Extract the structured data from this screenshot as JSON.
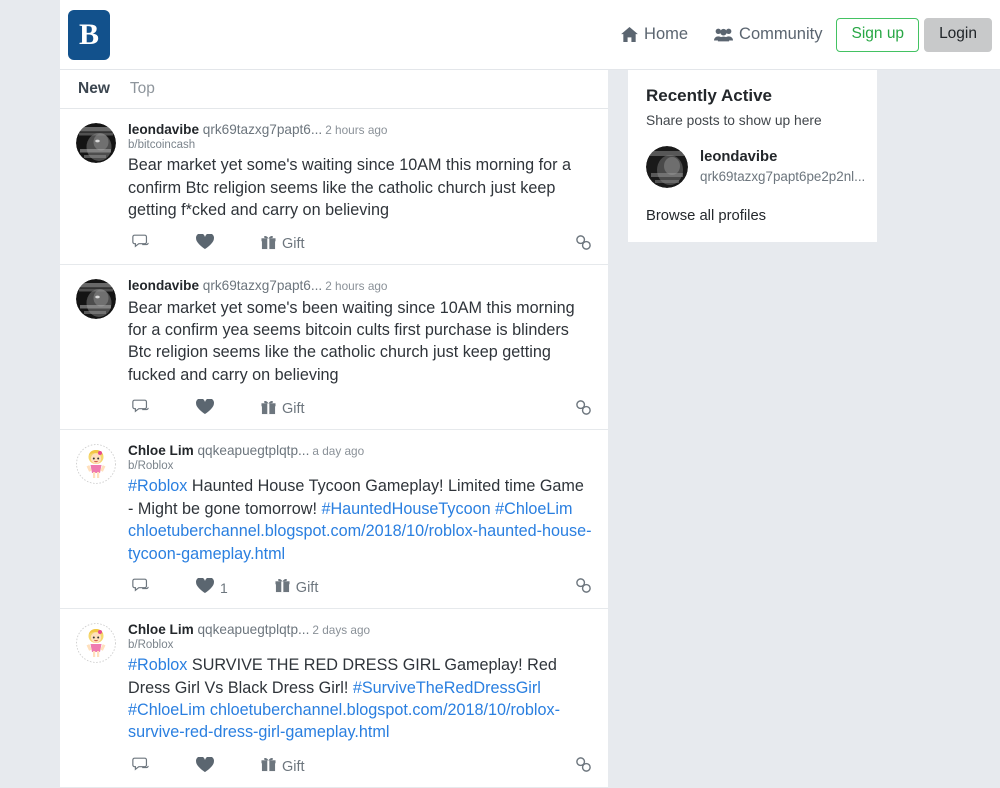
{
  "header": {
    "logo_letter": "B",
    "nav": [
      {
        "label": "Home",
        "icon": "home-icon"
      },
      {
        "label": "Community",
        "icon": "community-icon"
      }
    ],
    "signup_label": "Sign up",
    "login_label": "Login"
  },
  "feed": {
    "tabs": [
      {
        "label": "New",
        "active": true
      },
      {
        "label": "Top",
        "active": false
      }
    ],
    "posts": [
      {
        "author": "leondavibe",
        "handle": "qrk69tazxg7papt6...",
        "time": "2 hours ago",
        "board": "b/bitcoincash",
        "avatar": "leondavibe-avatar",
        "text": "Bear market yet some's waiting since 10AM this morning for a confirm Btc religion seems like the catholic church just keep getting f*cked and carry on believing",
        "gift_label": "Gift",
        "like_count": ""
      },
      {
        "author": "leondavibe",
        "handle": "qrk69tazxg7papt6...",
        "time": "2 hours ago",
        "board": "",
        "avatar": "leondavibe-avatar",
        "text": "Bear market yet some's been waiting since 10AM this morning for a confirm yea seems bitcoin cults first purchase is blinders Btc religion seems like the catholic church just keep getting fucked and carry on believing",
        "gift_label": "Gift",
        "like_count": ""
      },
      {
        "author": "Chloe Lim",
        "handle": "qqkeapuegtplqtp...",
        "time": "a day ago",
        "board": "b/Roblox",
        "avatar": "chloelim-avatar",
        "text_parts": [
          {
            "t": "#Roblox",
            "link": true
          },
          {
            "t": " Haunted House Tycoon Gameplay! Limited time Game - Might be gone tomorrow! ",
            "link": false
          },
          {
            "t": "#HauntedHouseTycoon",
            "link": true
          },
          {
            "t": " ",
            "link": false
          },
          {
            "t": "#ChloeLim",
            "link": true
          },
          {
            "t": " ",
            "link": false
          },
          {
            "t": "chloetuberchannel.blogspot.com/2018/10/roblox-haunted-house-tycoon-gameplay.html",
            "link": true
          }
        ],
        "gift_label": "Gift",
        "like_count": "1"
      },
      {
        "author": "Chloe Lim",
        "handle": "qqkeapuegtplqtp...",
        "time": "2 days ago",
        "board": "b/Roblox",
        "avatar": "chloelim-avatar",
        "text_parts": [
          {
            "t": "#Roblox",
            "link": true
          },
          {
            "t": " SURVIVE THE RED DRESS GIRL Gameplay! Red Dress Girl Vs Black Dress Girl! ",
            "link": false
          },
          {
            "t": "#SurviveTheRedDressGirl",
            "link": true
          },
          {
            "t": " ",
            "link": false
          },
          {
            "t": "#ChloeLim",
            "link": true
          },
          {
            "t": " ",
            "link": false
          },
          {
            "t": "chloetuberchannel.blogspot.com/2018/10/roblox-survive-red-dress-girl-gameplay.html",
            "link": true
          }
        ],
        "gift_label": "Gift",
        "like_count": ""
      }
    ]
  },
  "sidebar": {
    "title": "Recently Active",
    "subtitle": "Share posts to show up here",
    "profile": {
      "name": "leondavibe",
      "handle": "qrk69tazxg7papt6pe2p2nl..."
    },
    "browse_label": "Browse all profiles"
  },
  "colors": {
    "page_bg": "#e7eaee",
    "card_bg": "#ffffff",
    "link": "#2a7fe0",
    "brand": "#12518c",
    "signup_green": "#28a745",
    "login_gray": "#c8c9ca"
  }
}
